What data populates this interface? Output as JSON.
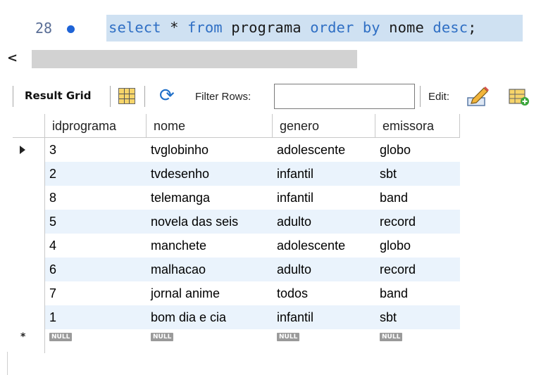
{
  "editor": {
    "line_number": "28",
    "sql_tokens": [
      {
        "text": "select",
        "kind": "kw"
      },
      {
        "text": " * ",
        "kind": "plain"
      },
      {
        "text": "from",
        "kind": "kw"
      },
      {
        "text": " programa ",
        "kind": "plain"
      },
      {
        "text": "order by",
        "kind": "kw"
      },
      {
        "text": " nome ",
        "kind": "plain"
      },
      {
        "text": "desc",
        "kind": "kw"
      },
      {
        "text": ";",
        "kind": "plain"
      }
    ]
  },
  "scroll": {
    "left_arrow": "<"
  },
  "toolbar": {
    "result_grid_label": "Result Grid",
    "filter_rows_label": "Filter Rows:",
    "filter_value": "",
    "edit_label": "Edit:"
  },
  "grid": {
    "columns": [
      "idprograma",
      "nome",
      "genero",
      "emissora"
    ],
    "rows": [
      [
        "3",
        "tvglobinho",
        "adolescente",
        "globo"
      ],
      [
        "2",
        "tvdesenho",
        "infantil",
        "sbt"
      ],
      [
        "8",
        "telemanga",
        "infantil",
        "band"
      ],
      [
        "5",
        "novela das seis",
        "adulto",
        "record"
      ],
      [
        "4",
        "manchete",
        "adolescente",
        "globo"
      ],
      [
        "6",
        "malhacao",
        "adulto",
        "record"
      ],
      [
        "7",
        "jornal anime",
        "todos",
        "band"
      ],
      [
        "1",
        "bom dia e cia",
        "infantil",
        "sbt"
      ]
    ],
    "new_row_values": [
      "NULL",
      "NULL",
      "NULL",
      "NULL"
    ],
    "current_row_index": 0
  },
  "colors": {
    "keyword": "#2f6fc4",
    "selection": "#cfe1f2",
    "alt_row": "#eaf3fc",
    "null_badge": "#9a9a9a"
  }
}
